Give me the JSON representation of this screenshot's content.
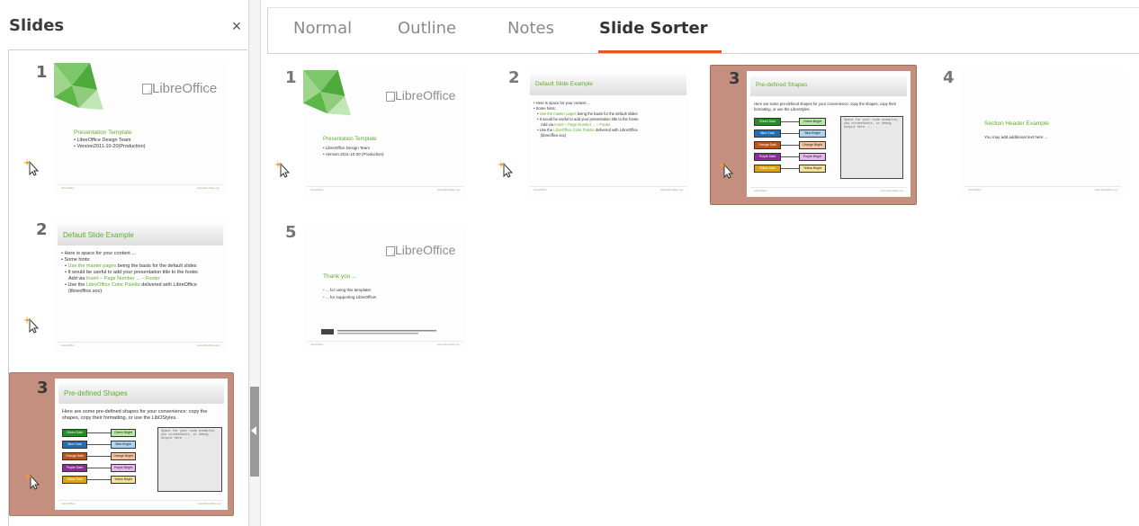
{
  "slides_pane": {
    "title": "Slides",
    "close_glyph": "×",
    "items": [
      {
        "number": "1"
      },
      {
        "number": "2"
      },
      {
        "number": "3"
      }
    ]
  },
  "tabs": [
    {
      "label": "Normal"
    },
    {
      "label": "Outline"
    },
    {
      "label": "Notes"
    },
    {
      "label": "Slide Sorter",
      "active": true
    }
  ],
  "sorter": {
    "items": [
      {
        "number": "1"
      },
      {
        "number": "2"
      },
      {
        "number": "3"
      },
      {
        "number": "4"
      },
      {
        "number": "5"
      }
    ]
  },
  "slide1": {
    "logo": "LibreOffice",
    "title": "Presentation Template",
    "bullets": [
      "LibreOffice Design Team",
      "Version 2011-10-20 (Production)"
    ],
    "pane_bullets": [
      "LibreOffice Design Team",
      "Version2011-10-20(Production)"
    ]
  },
  "slide2": {
    "title": "Default Slide Example",
    "lines": [
      "Here is space for your content ...",
      "Some hints:",
      "Use the master pages being the basis for the default slides",
      "It would be useful to add your presentation title to the footer.",
      "Add via Insert – Page Number ... – Footer",
      "Use the LibreOffice Color Palette delivered with LibreOffice",
      "(libreoffice.soc)"
    ]
  },
  "slide3": {
    "title": "Pre-defined Shapes",
    "intro": "Here are some pre-defined shapes for your convenience: copy the shapes, copy their formatting, or use the LibreStyles.",
    "pane_intro": "Here are some pre-defined shapes for your convenience: copy the shapes, copy their formatting, or use the LibOStyles.",
    "dark": [
      "Green Dark",
      "Blue Dark",
      "Orange Dark",
      "Purple Dark",
      "Yellow Dark"
    ],
    "bright": [
      "Green Bright",
      "Blue Bright",
      "Orange Bright",
      "Purple Bright",
      "Yellow Bright"
    ],
    "code": "Space for your code examples, you screenshots, or debug output here ...",
    "colors_dark": [
      "#2a8a2a",
      "#1c6fb4",
      "#b5561d",
      "#8e2b9a",
      "#d9a31c"
    ],
    "colors_bright": [
      "#b6e8a6",
      "#a9d6f2",
      "#f5c6a4",
      "#e7b6ec",
      "#f7e19d"
    ]
  },
  "slide4": {
    "title": "Section Header Example",
    "text": "You may add additional text here ..."
  },
  "slide5": {
    "logo": "LibreOffice",
    "title": "Thank you ...",
    "bullets": [
      "... for using this template!",
      "... for supporting LibreOffice!"
    ]
  },
  "footer": {
    "left": "LibreOffice",
    "right": "www.libreoffice.org"
  },
  "icons": {
    "cursor": "cursor-sparkle-icon",
    "close": "close-icon",
    "collapse": "chevron-left-icon"
  },
  "colors": {
    "accent": "#e95420",
    "selection": "#c48f7f",
    "libre_green": "#5fae2f"
  }
}
